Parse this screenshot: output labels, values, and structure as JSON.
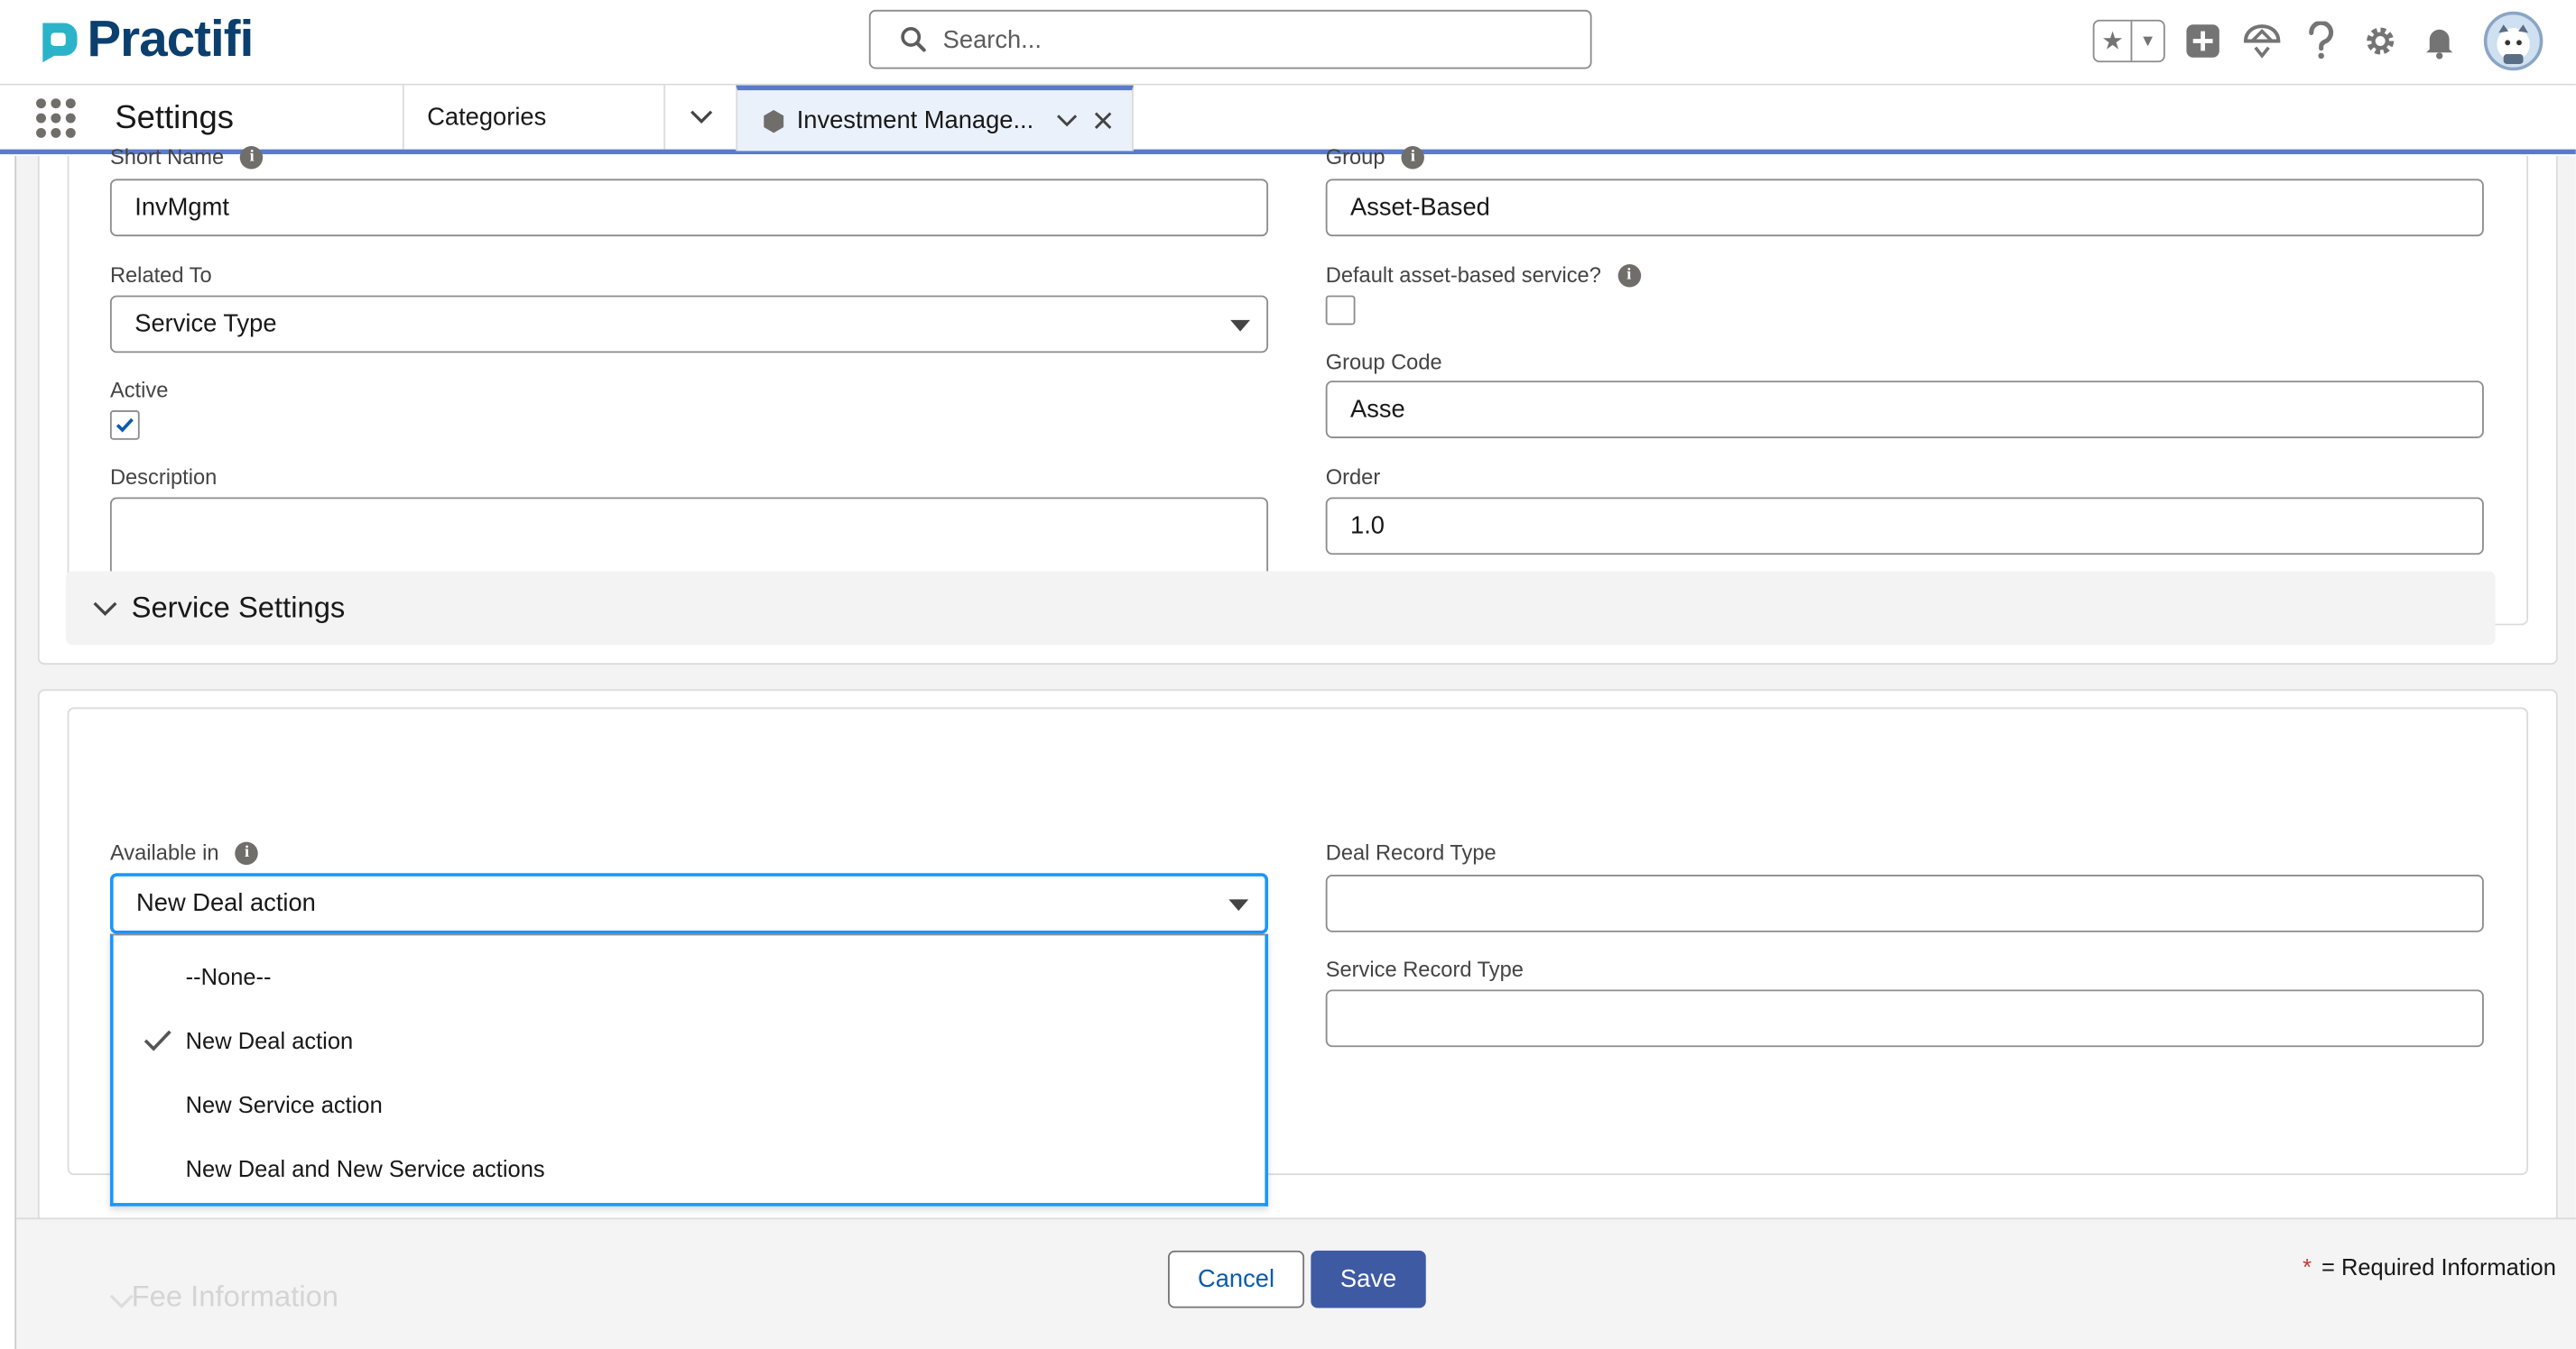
{
  "header": {
    "logo_text": "Practifi",
    "search_placeholder": "Search...",
    "icons": [
      "star-icon",
      "chevron-down-icon",
      "add-icon",
      "trailhead-icon",
      "help-icon",
      "setup-gear-icon",
      "notification-bell-icon",
      "avatar"
    ]
  },
  "nav": {
    "app_name": "Settings",
    "item": "Categories",
    "tab_label": "Investment Manage..."
  },
  "form": {
    "short_name_label": "Short Name",
    "short_name_value": "InvMgmt",
    "group_label": "Group",
    "group_value": "Asset-Based",
    "related_to_label": "Related To",
    "related_to_value": "Service Type",
    "default_label": "Default asset-based service?",
    "default_checked": false,
    "active_label": "Active",
    "active_checked": true,
    "group_code_label": "Group Code",
    "group_code_value": "Asse",
    "description_label": "Description",
    "description_value": "",
    "order_label": "Order",
    "order_value": "1.0"
  },
  "service_settings": {
    "title": "Service Settings",
    "available_in_label": "Available in",
    "available_in_value": "New Deal action",
    "deal_record_type_label": "Deal Record Type",
    "deal_record_type_value": "",
    "service_record_type_label": "Service Record Type",
    "service_record_type_value": "",
    "options": [
      "--None--",
      "New Deal action",
      "New Service action",
      "New Deal and New Service actions"
    ],
    "selected_option": "New Deal action"
  },
  "footer": {
    "next_section": "Fee Information",
    "cancel_label": "Cancel",
    "save_label": "Save",
    "required_star": "*",
    "required_text": "= Required Information"
  },
  "colors": {
    "brand": "#0b3f6e",
    "accent": "#5b7ac9",
    "save_button": "#3e5aa3",
    "focus": "#1b96ff"
  }
}
